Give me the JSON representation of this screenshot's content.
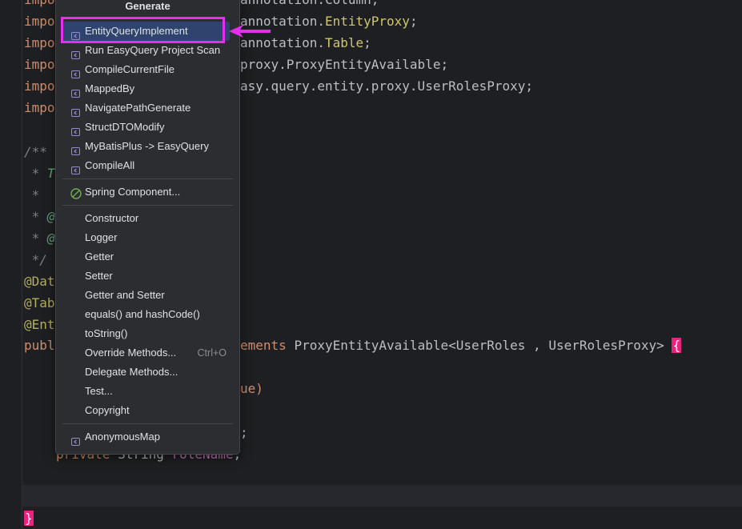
{
  "editor": {
    "lines": {
      "l1_kw": "impo",
      "l1_rest": "annotation.Column;",
      "l2_kw": "impo",
      "l2_rest_a": "annotation.",
      "l2_rest_b": "EntityProxy",
      "l2_rest_c": ";",
      "l3_kw": "impo",
      "l3_rest_a": "annotation.",
      "l3_rest_b": "Table",
      "l3_rest_c": ";",
      "l4_kw": "impo",
      "l4_rest": "proxy.ProxyEntityAvailable;",
      "l5_kw": "impo",
      "l5_rest": "asy.query.entity.proxy.UserRolesProxy;",
      "l6_kw": "impo",
      "l8": "/**",
      "l9_a": " * ",
      "l9_b": "T",
      "l10": " *",
      "l11_a": " * ",
      "l11_b": "@",
      "l12_a": " * ",
      "l12_b": "@",
      "l13": " */",
      "l14": "@Dat",
      "l15": "@Tab",
      "l16": "@Ent",
      "l17_kw": "publ",
      "l17_rest_a": "ements ",
      "l17_rest_b": "ProxyEntityAvailable<UserRoles , UserRolesProxy> ",
      "l17_brace": "{",
      "l19": "ue)",
      "l21": ";",
      "l22_kw": "private ",
      "l22_type": "String ",
      "l22_field": "roleName",
      "l22_end": ";",
      "l24_brace": "}"
    }
  },
  "popup": {
    "title": "Generate",
    "groups": [
      {
        "items": [
          {
            "label": "EntityQueryImplement",
            "icon": "plugin-icon",
            "selected": true
          },
          {
            "label": "Run EasyQuery Project Scan",
            "icon": "plugin-icon"
          },
          {
            "label": "CompileCurrentFile",
            "icon": "plugin-icon"
          },
          {
            "label": "MappedBy",
            "icon": "plugin-icon"
          },
          {
            "label": "NavigatePathGenerate",
            "icon": "plugin-icon"
          },
          {
            "label": "StructDTOModify",
            "icon": "plugin-icon"
          },
          {
            "label": "MyBatisPlus -> EasyQuery",
            "icon": "plugin-icon"
          },
          {
            "label": "CompileAll",
            "icon": "plugin-icon"
          }
        ]
      },
      {
        "items": [
          {
            "label": "Spring Component...",
            "icon": "spring-icon"
          }
        ]
      },
      {
        "items": [
          {
            "label": "Constructor"
          },
          {
            "label": "Logger"
          },
          {
            "label": "Getter"
          },
          {
            "label": "Setter"
          },
          {
            "label": "Getter and Setter"
          },
          {
            "label": "equals() and hashCode()"
          },
          {
            "label": "toString()"
          },
          {
            "label": "Override Methods...",
            "shortcut": "Ctrl+O"
          },
          {
            "label": "Delegate Methods..."
          },
          {
            "label": "Test..."
          },
          {
            "label": "Copyright"
          }
        ]
      },
      {
        "items": [
          {
            "label": "AnonymousMap",
            "icon": "plugin-icon"
          }
        ]
      }
    ]
  },
  "colors": {
    "highlight_box": "#e62ef0",
    "arrow": "#e62ef0",
    "selected_bg": "#2e436e",
    "brace_highlight": "#e8247f"
  }
}
